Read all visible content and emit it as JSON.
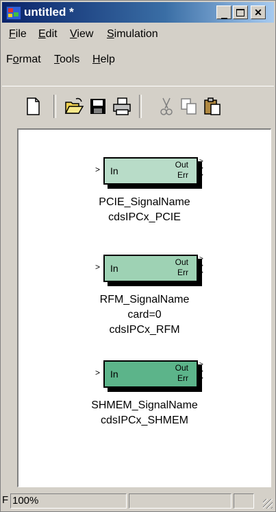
{
  "window": {
    "title": "untitled *"
  },
  "menu": [
    {
      "label_pre": "",
      "label_u": "F",
      "label_post": "ile"
    },
    {
      "label_pre": "",
      "label_u": "E",
      "label_post": "dit"
    },
    {
      "label_pre": "",
      "label_u": "V",
      "label_post": "iew"
    },
    {
      "label_pre": "",
      "label_u": "S",
      "label_post": "imulation"
    },
    {
      "label_pre": "F",
      "label_u": "o",
      "label_post": "rmat"
    },
    {
      "label_pre": "",
      "label_u": "T",
      "label_post": "ools"
    },
    {
      "label_pre": "",
      "label_u": "H",
      "label_post": "elp"
    }
  ],
  "toolbar": [
    "new-icon",
    "open-icon",
    "save-icon",
    "print-icon",
    "cut-icon",
    "copy-icon",
    "paste-icon"
  ],
  "blocks": [
    {
      "in": "In",
      "out": "Out",
      "err": "Err",
      "name": "PCIE_SignalName",
      "param": "",
      "type": "cdsIPCx_PCIE",
      "color": "#b8dcc8"
    },
    {
      "in": "In",
      "out": "Out",
      "err": "Err",
      "name": "RFM_SignalName",
      "param": "card=0",
      "type": "cdsIPCx_RFM",
      "color": "#9ed2b4"
    },
    {
      "in": "In",
      "out": "Out",
      "err": "Err",
      "name": "SHMEM_SignalName",
      "param": "",
      "type": "cdsIPCx_SHMEM",
      "color": "#5cb48a"
    }
  ],
  "status": {
    "left": "F",
    "zoom": "100%"
  }
}
